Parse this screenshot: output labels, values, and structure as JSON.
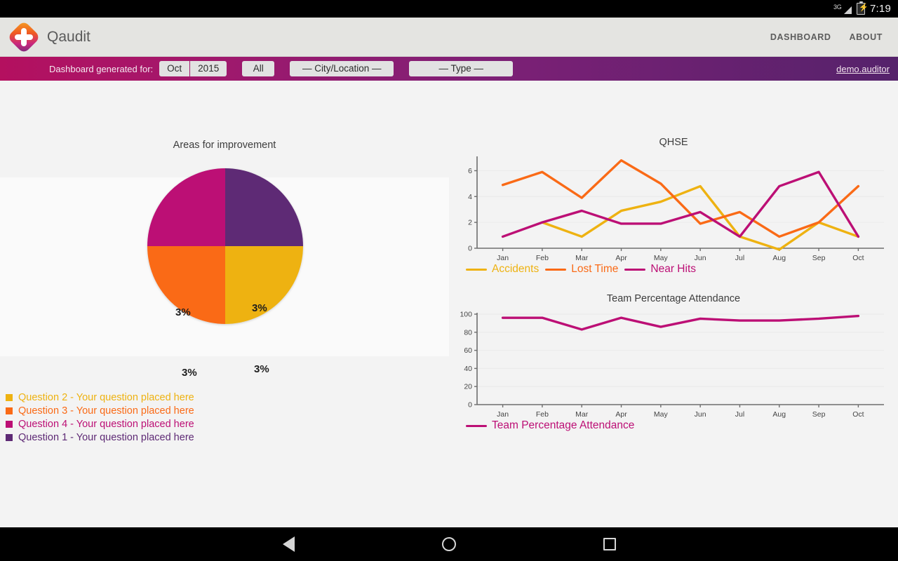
{
  "statusbar": {
    "network": "3G",
    "time": "7:19",
    "signal_icon": "signal-bars-icon",
    "battery_icon": "battery-charging-icon"
  },
  "header": {
    "brand": "Qaudit",
    "logo_icon": "qaudit-logo-icon",
    "nav": [
      {
        "label": "DASHBOARD"
      },
      {
        "label": "ABOUT"
      }
    ]
  },
  "filterbar": {
    "label": "Dashboard generated for:",
    "month": "Oct",
    "year": "2015",
    "scope": "All",
    "city": "— City/Location —",
    "type": "— Type —",
    "user": "demo.auditor"
  },
  "colors": {
    "yellow": "#eeb211",
    "orange": "#fa6a16",
    "magenta": "#bc0f75",
    "purple": "#5e2a75",
    "axis": "#6e6e6e",
    "grid": "#eaeaea"
  },
  "pie_legend": [
    {
      "label": "Question 2 - Your question placed here",
      "color": "#eeb211"
    },
    {
      "label": "Question 3 - Your question placed here",
      "color": "#fa6a16"
    },
    {
      "label": "Question 4 - Your question placed here",
      "color": "#bc0f75"
    },
    {
      "label": "Question 1 - Your question placed here",
      "color": "#5e2a75"
    }
  ],
  "chart_data": [
    {
      "type": "pie",
      "title": "Areas for improvement",
      "labels": [
        "Question 1",
        "Question 2",
        "Question 3",
        "Question 4"
      ],
      "slices": [
        {
          "name": "Question 1 - Your question placed here",
          "value": 3,
          "display": "3%",
          "color": "#5e2a75",
          "position": "top-right"
        },
        {
          "name": "Question 2 - Your question placed here",
          "value": 3,
          "display": "3%",
          "color": "#eeb211",
          "position": "bottom-right"
        },
        {
          "name": "Question 3 - Your question placed here",
          "value": 3,
          "display": "3%",
          "color": "#fa6a16",
          "position": "bottom-left"
        },
        {
          "name": "Question 4 - Your question placed here",
          "value": 3,
          "display": "3%",
          "color": "#bc0f75",
          "position": "top-left"
        }
      ],
      "legend_position": "bottom-left"
    },
    {
      "type": "line",
      "title": "QHSE",
      "categories": [
        "Jan",
        "Feb",
        "Mar",
        "Apr",
        "May",
        "Jun",
        "Jul",
        "Aug",
        "Sep",
        "Oct"
      ],
      "xlabel": "",
      "ylabel": "",
      "ylim": [
        0,
        7
      ],
      "yticks": [
        0,
        2,
        4,
        6
      ],
      "grid": true,
      "legend_position": "bottom",
      "series": [
        {
          "name": "Accidents",
          "color": "#eeb211",
          "values": [
            null,
            2,
            0.9,
            2.9,
            3.6,
            4.8,
            0.9,
            -0.1,
            2,
            0.9
          ]
        },
        {
          "name": "Lost Time",
          "color": "#fa6a16",
          "values": [
            4.9,
            5.9,
            3.9,
            6.8,
            5,
            1.9,
            2.8,
            0.9,
            2,
            4.8
          ]
        },
        {
          "name": "Near Hits",
          "color": "#bc0f75",
          "values": [
            0.9,
            2,
            2.9,
            1.9,
            1.9,
            2.8,
            0.9,
            4.8,
            5.9,
            0.9
          ]
        }
      ]
    },
    {
      "type": "line",
      "title": "Team Percentage Attendance",
      "categories": [
        "Jan",
        "Feb",
        "Mar",
        "Apr",
        "May",
        "Jun",
        "Jul",
        "Aug",
        "Sep",
        "Oct"
      ],
      "xlabel": "",
      "ylabel": "",
      "ylim": [
        0,
        100
      ],
      "yticks": [
        0,
        20,
        40,
        60,
        80,
        100
      ],
      "grid": true,
      "legend_position": "bottom",
      "series": [
        {
          "name": "Team Percentage Attendance",
          "color": "#bc0f75",
          "values": [
            96,
            96,
            83,
            96,
            86,
            95,
            93,
            93,
            95,
            98
          ]
        }
      ]
    }
  ],
  "navbar": {
    "back": "back-icon",
    "home": "home-icon",
    "recents": "recents-icon"
  }
}
